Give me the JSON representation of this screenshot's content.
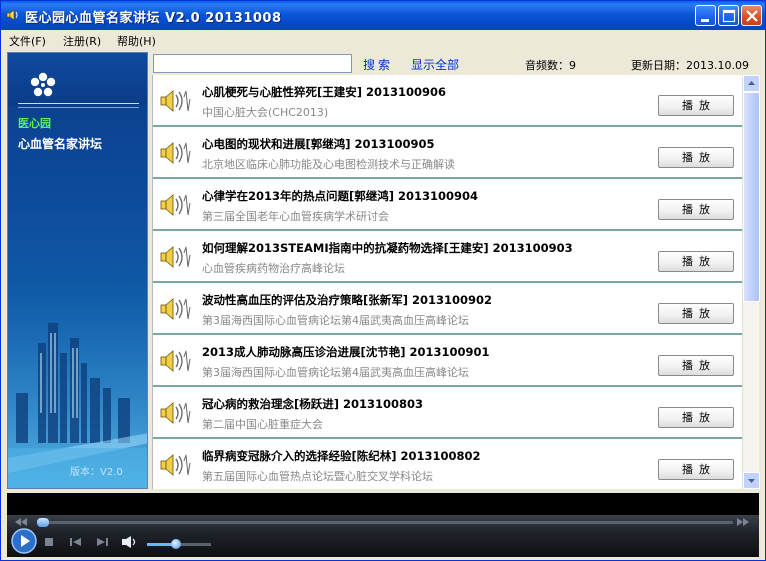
{
  "window": {
    "title": "医心园心血管名家讲坛  V2.0   20131008"
  },
  "menu": [
    {
      "label": "文件(F)"
    },
    {
      "label": "注册(R)"
    },
    {
      "label": "帮助(H)"
    }
  ],
  "sidebar": {
    "brand_name": "医心园",
    "brand_subtitle": "心血管名家讲坛",
    "version": "版本：V2.0"
  },
  "toolbar": {
    "search_value": "",
    "search_label": "搜索",
    "show_all_label": "显示全部",
    "count_label": "音频数：9",
    "date_label": "更新日期：2013.10.09"
  },
  "list": {
    "play_label": "播放",
    "items": [
      {
        "title": "心肌梗死与心脏性猝死[王建安]   2013100906",
        "subtitle": "中国心脏大会(CHC2013)"
      },
      {
        "title": "心电图的现状和进展[郭继鸿]   2013100905",
        "subtitle": "北京地区临床心肺功能及心电图检测技术与正确解读"
      },
      {
        "title": "心律学在2013年的热点问题[郭继鸿]  2013100904",
        "subtitle": "第三届全国老年心血管疾病学术研讨会"
      },
      {
        "title": "如何理解2013STEAMI指南中的抗凝药物选择[王建安]   2013100903",
        "subtitle": "心血管疾病药物治疗高峰论坛"
      },
      {
        "title": "波动性高血压的评估及治疗策略[张新军]   2013100902",
        "subtitle": "第3届海西国际心血管病论坛第4届武夷高血压高峰论坛"
      },
      {
        "title": "2013成人肺动脉高压诊治进展[沈节艳]   2013100901",
        "subtitle": "第3届海西国际心血管病论坛第4届武夷高血压高峰论坛"
      },
      {
        "title": "冠心病的救治理念[杨跃进]   2013100803",
        "subtitle": "第二届中国心脏重症大会"
      },
      {
        "title": "临界病变冠脉介入的选择经验[陈纪林]   2013100802",
        "subtitle": "第五届国际心血管热点论坛暨心脏交叉学科论坛"
      }
    ]
  },
  "player": {
    "seek_position": 0.0,
    "volume_level": 0.45
  },
  "colors": {
    "titlebar": "#0b56d8",
    "link": "#0033cc",
    "brand_green": "#5df05d",
    "row_divider": "#7aa7a6"
  },
  "icons": {
    "app": "speaker-icon",
    "list_item": "speaker-sound-wave-icon"
  }
}
